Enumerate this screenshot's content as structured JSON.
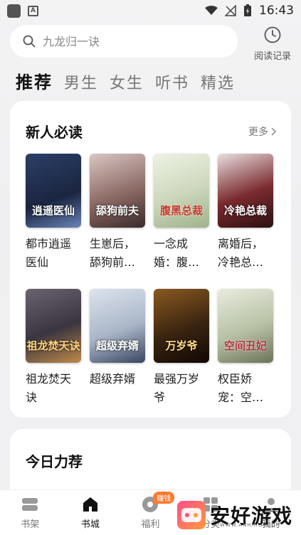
{
  "status_bar": {
    "time": "16:43"
  },
  "search": {
    "placeholder": "九龙归一诀",
    "history_label": "阅读记录"
  },
  "tabs": [
    {
      "label": "推荐",
      "active": true
    },
    {
      "label": "男生",
      "active": false
    },
    {
      "label": "女生",
      "active": false
    },
    {
      "label": "听书",
      "active": false
    },
    {
      "label": "精选",
      "active": false
    }
  ],
  "section_new": {
    "title": "新人必读",
    "more_label": "更多",
    "books": [
      {
        "title": "都市逍遥医仙",
        "cover_text": "逍遥医仙",
        "cover_color": "#3a5a8c"
      },
      {
        "title": "生崽后，舔狗前…",
        "cover_text": "舔狗前夫",
        "cover_color": "#8c6a66"
      },
      {
        "title": "一念成婚：腹…",
        "cover_text": "腹黑总裁",
        "cover_color": "#cfd9bf"
      },
      {
        "title": "离婚后，冷艳总…",
        "cover_text": "冷艳总裁",
        "cover_color": "#7a2a2e"
      },
      {
        "title": "祖龙焚天诀",
        "cover_text": "祖龙焚天诀",
        "cover_color": "#4f4a52"
      },
      {
        "title": "超级弃婿",
        "cover_text": "超级弃婿",
        "cover_color": "#aab6c8"
      },
      {
        "title": "最强万岁爷",
        "cover_text": "万岁爷",
        "cover_color": "#3a2410"
      },
      {
        "title": "权臣娇宠：空…",
        "cover_text": "空间丑妃",
        "cover_color": "#b8c1a4"
      }
    ]
  },
  "section_today": {
    "title": "今日力荐"
  },
  "bottom_nav": [
    {
      "label": "书架",
      "icon": "bookshelf-icon",
      "active": false
    },
    {
      "label": "书城",
      "icon": "bookstore-icon",
      "active": true
    },
    {
      "label": "福利",
      "icon": "gift-icon",
      "active": false,
      "badge": "赚钱"
    },
    {
      "label": "分类",
      "icon": "category-icon",
      "active": false
    },
    {
      "label": "我的",
      "icon": "profile-icon",
      "active": false
    }
  ],
  "watermark": {
    "text": "安好游戏",
    "sub": "WWW.ANHH.GROUP"
  }
}
